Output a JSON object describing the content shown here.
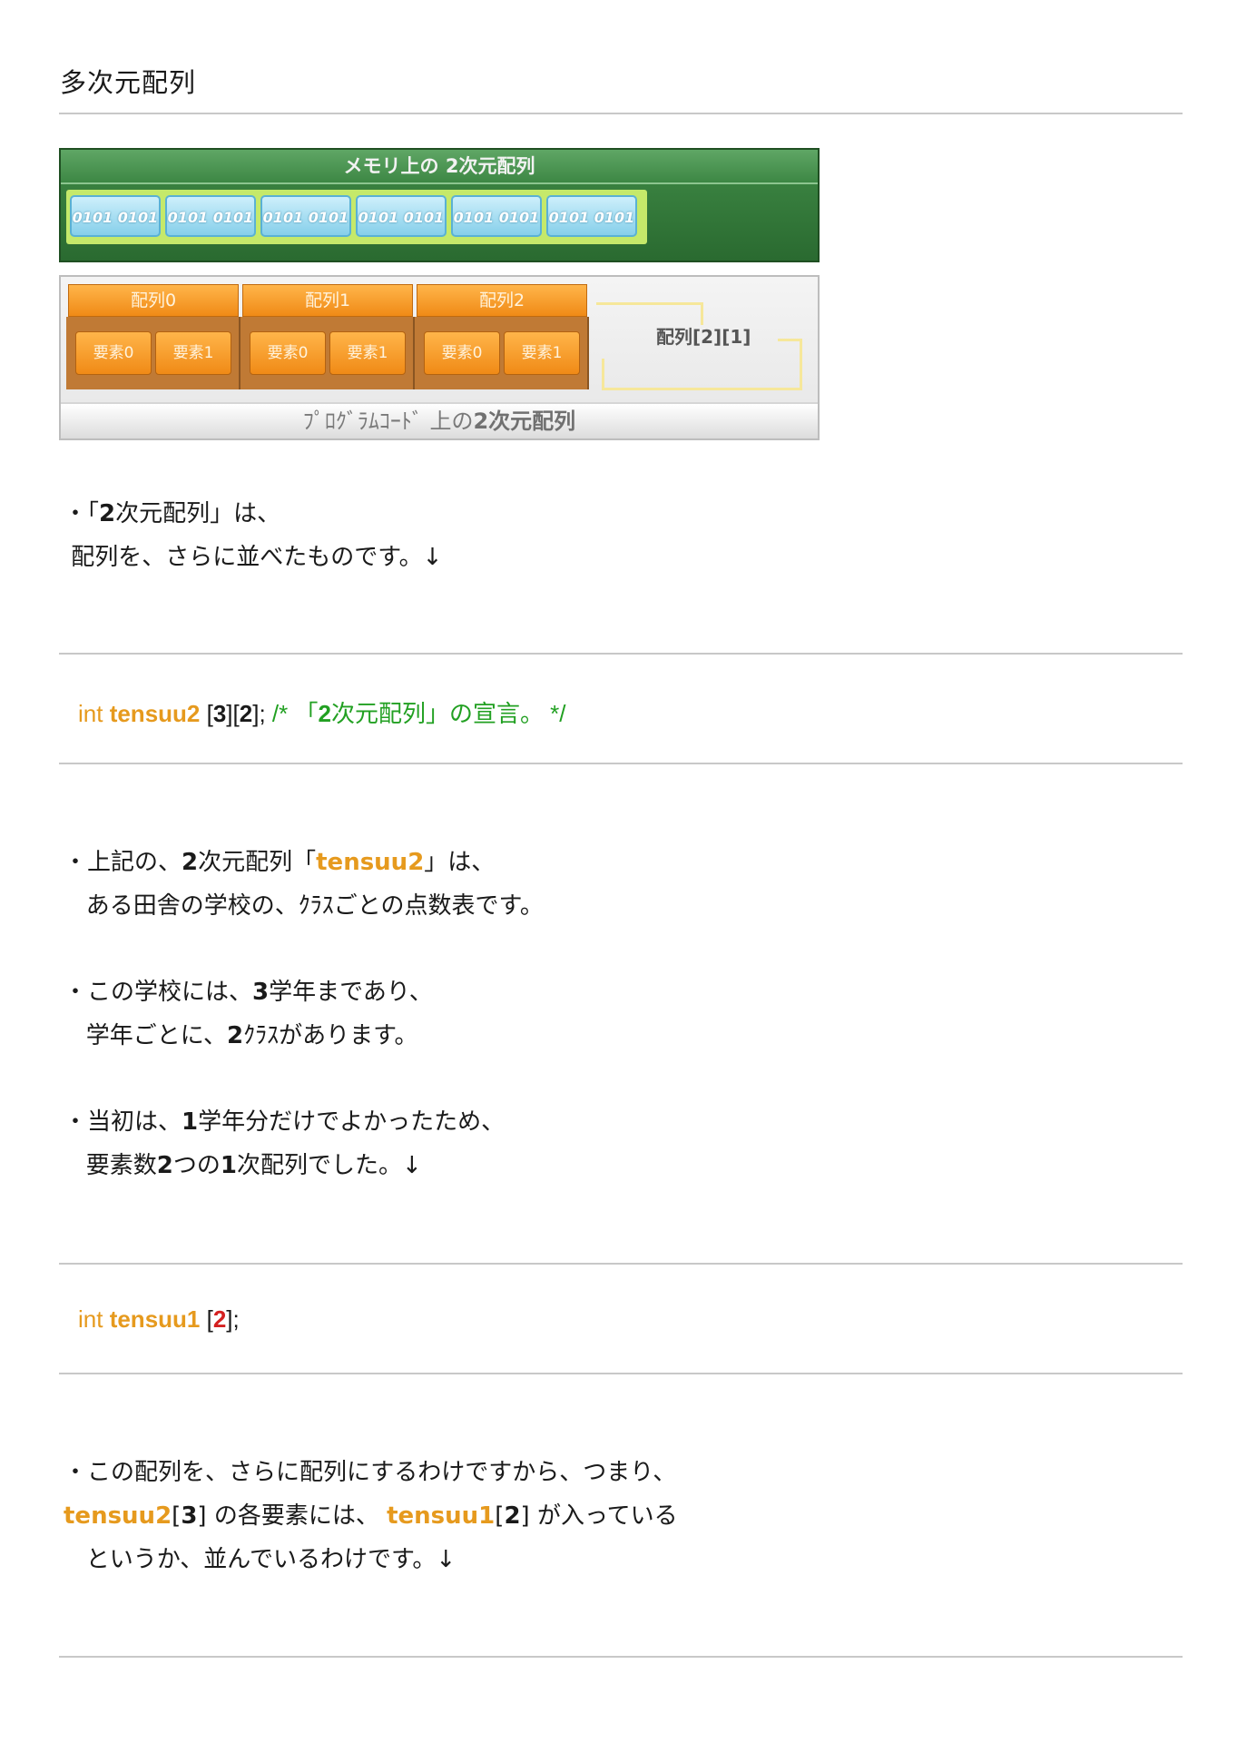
{
  "title": "多次元配列",
  "figure": {
    "memory_title": "メモリ上の 2次元配列",
    "memory_cells": [
      "0101 0101",
      "0101 0101",
      "0101 0101",
      "0101 0101",
      "0101 0101",
      "0101 0101"
    ],
    "arrays": [
      {
        "label": "配列0",
        "elements": [
          "要素0",
          "要素1"
        ]
      },
      {
        "label": "配列1",
        "elements": [
          "要素0",
          "要素1"
        ]
      },
      {
        "label": "配列2",
        "elements": [
          "要素0",
          "要素1"
        ]
      }
    ],
    "index_label": "配列[2][1]",
    "code_caption_prefix": "ﾌﾟﾛｸﾞﾗﾑｺｰﾄﾞ 上の",
    "code_caption_bold": "2次元配列"
  },
  "para1": {
    "line1_a": "・「",
    "line1_b": "2",
    "line1_c": "次元配列」は、",
    "line2": " 配列を、さらに並べたものです。↓"
  },
  "code1": {
    "kw": "int ",
    "name": "tensuu2",
    "b1": " [",
    "n1": "3",
    "b2": "][",
    "n2": "2",
    "b3": "]; ",
    "comment_a": "/* 「",
    "comment_b": "2",
    "comment_c": "次元配列」の宣言。 */"
  },
  "para2": {
    "l1_a": "・上記の、",
    "l1_b": "2",
    "l1_c": "次元配列「",
    "l1_d": "tensuu2",
    "l1_e": "」は、",
    "l2": "   ある田舎の学校の、ｸﾗｽごとの点数表です。"
  },
  "para3": {
    "l1_a": "・この学校には、",
    "l1_b": "3",
    "l1_c": "学年まであり、",
    "l2_a": "   学年ごとに、",
    "l2_b": "2",
    "l2_c": "ｸﾗｽがあります。"
  },
  "para4": {
    "l1_a": "・当初は、",
    "l1_b": "1",
    "l1_c": "学年分だけでよかったため、",
    "l2_a": "   要素数",
    "l2_b": "2",
    "l2_c": "つの",
    "l2_d": "1",
    "l2_e": "次配列でした。↓"
  },
  "code2": {
    "kw": "int ",
    "name": "tensuu1",
    "b1": " [",
    "n1": "2",
    "b2": "];"
  },
  "para5": {
    "l1": "・この配列を、さらに配列にするわけですから、つまり、",
    "l2_a": "tensuu2",
    "l2_b": "[",
    "l2_c": "3",
    "l2_d": "] の各要素には、 ",
    "l2_e": "tensuu1",
    "l2_f": "[",
    "l2_g": "2",
    "l2_h": "] が入っている",
    "l3": "   というか、並んでいるわけです。↓"
  }
}
